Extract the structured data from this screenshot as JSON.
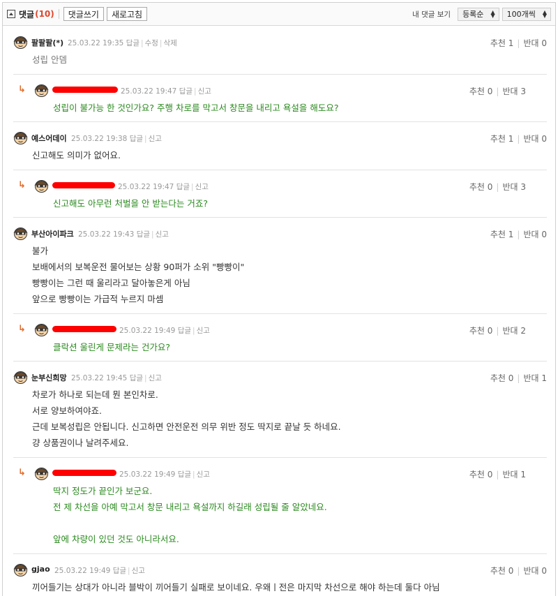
{
  "header": {
    "title": "댓글",
    "count": "(10)",
    "write_label": "댓글쓰기",
    "refresh_label": "새로고침",
    "my_comments_label": "내 댓글 보기",
    "sort_value": "등록순",
    "per_page_value": "100개씩"
  },
  "comments": [
    {
      "nick": "팔팔팔(*)",
      "date": "25.03.22 19:35",
      "actions": [
        "답글",
        "수정",
        "삭제"
      ],
      "up": "추천 1",
      "down": "반대 0",
      "lines": [
        "성립 안뎀"
      ]
    },
    {
      "nick": "",
      "date": "25.03.22 19:47",
      "actions": [
        "답글",
        "신고"
      ],
      "up": "추천 0",
      "down": "반대 3",
      "lines": [
        "성립이 불가능 한 것인가요? 주행 차로를 막고서 창문을 내리고 욕설을 해도요?"
      ]
    },
    {
      "nick": "예스어데이",
      "date": "25.03.22 19:38",
      "actions": [
        "답글",
        "신고"
      ],
      "up": "추천 1",
      "down": "반대 0",
      "lines": [
        "신고해도 의미가 없어요."
      ]
    },
    {
      "nick": "",
      "date": "25.03.22 19:47",
      "actions": [
        "답글",
        "신고"
      ],
      "up": "추천 0",
      "down": "반대 3",
      "lines": [
        "신고해도 아무런 처벌을 안 받는다는 거죠?"
      ]
    },
    {
      "nick": "부산아이파크",
      "date": "25.03.22 19:43",
      "actions": [
        "답글",
        "신고"
      ],
      "up": "추천 1",
      "down": "반대 0",
      "lines": [
        "불가",
        "보배에서의 보복운전 물어보는 상황 90퍼가 소위 \"빵빵이\"",
        "빵빵이는 그런 때 울리라고 달아놓은게 아님",
        "앞으로 빵빵이는 가급적 누르지 마셈"
      ]
    },
    {
      "nick": "",
      "date": "25.03.22 19:49",
      "actions": [
        "답글",
        "신고"
      ],
      "up": "추천 0",
      "down": "반대 2",
      "lines": [
        "클락션 울린게 문제라는 건가요?"
      ]
    },
    {
      "nick": "눈부신희망",
      "date": "25.03.22 19:45",
      "actions": [
        "답글",
        "신고"
      ],
      "up": "추천 0",
      "down": "반대 1",
      "lines": [
        "차로가 하나로 되는데 뭔 본인차로.",
        "서로 양보하여야죠.",
        "근데 보복성립은 안됩니다. 신고하면 안전운전 의무 위반 정도 딱지로 끝날 듯 하네요.",
        "걍 상품권이나 날려주세요."
      ]
    },
    {
      "nick": "",
      "date": "25.03.22 19:49",
      "actions": [
        "답글",
        "신고"
      ],
      "up": "추천 0",
      "down": "반대 1",
      "lines": [
        "딱지 정도가 끝인가 보군요.",
        "전 제 차선을 아예 막고서 창문 내리고 욕설까지 하길래 성립될 줄 알았네요.",
        "",
        "앞에 차량이 있던 것도 아니라서요."
      ]
    },
    {
      "nick": "gjao",
      "date": "25.03.22 19:49",
      "actions": [
        "답글",
        "신고"
      ],
      "up": "추천 0",
      "down": "반대 0",
      "lines": [
        "끼어들기는 상대가 아니라 블박이 끼어들기 실패로 보이네요. 우왜ㅣ전은 마지막 차선으로 해야 하는데 둘다 아님"
      ]
    }
  ]
}
